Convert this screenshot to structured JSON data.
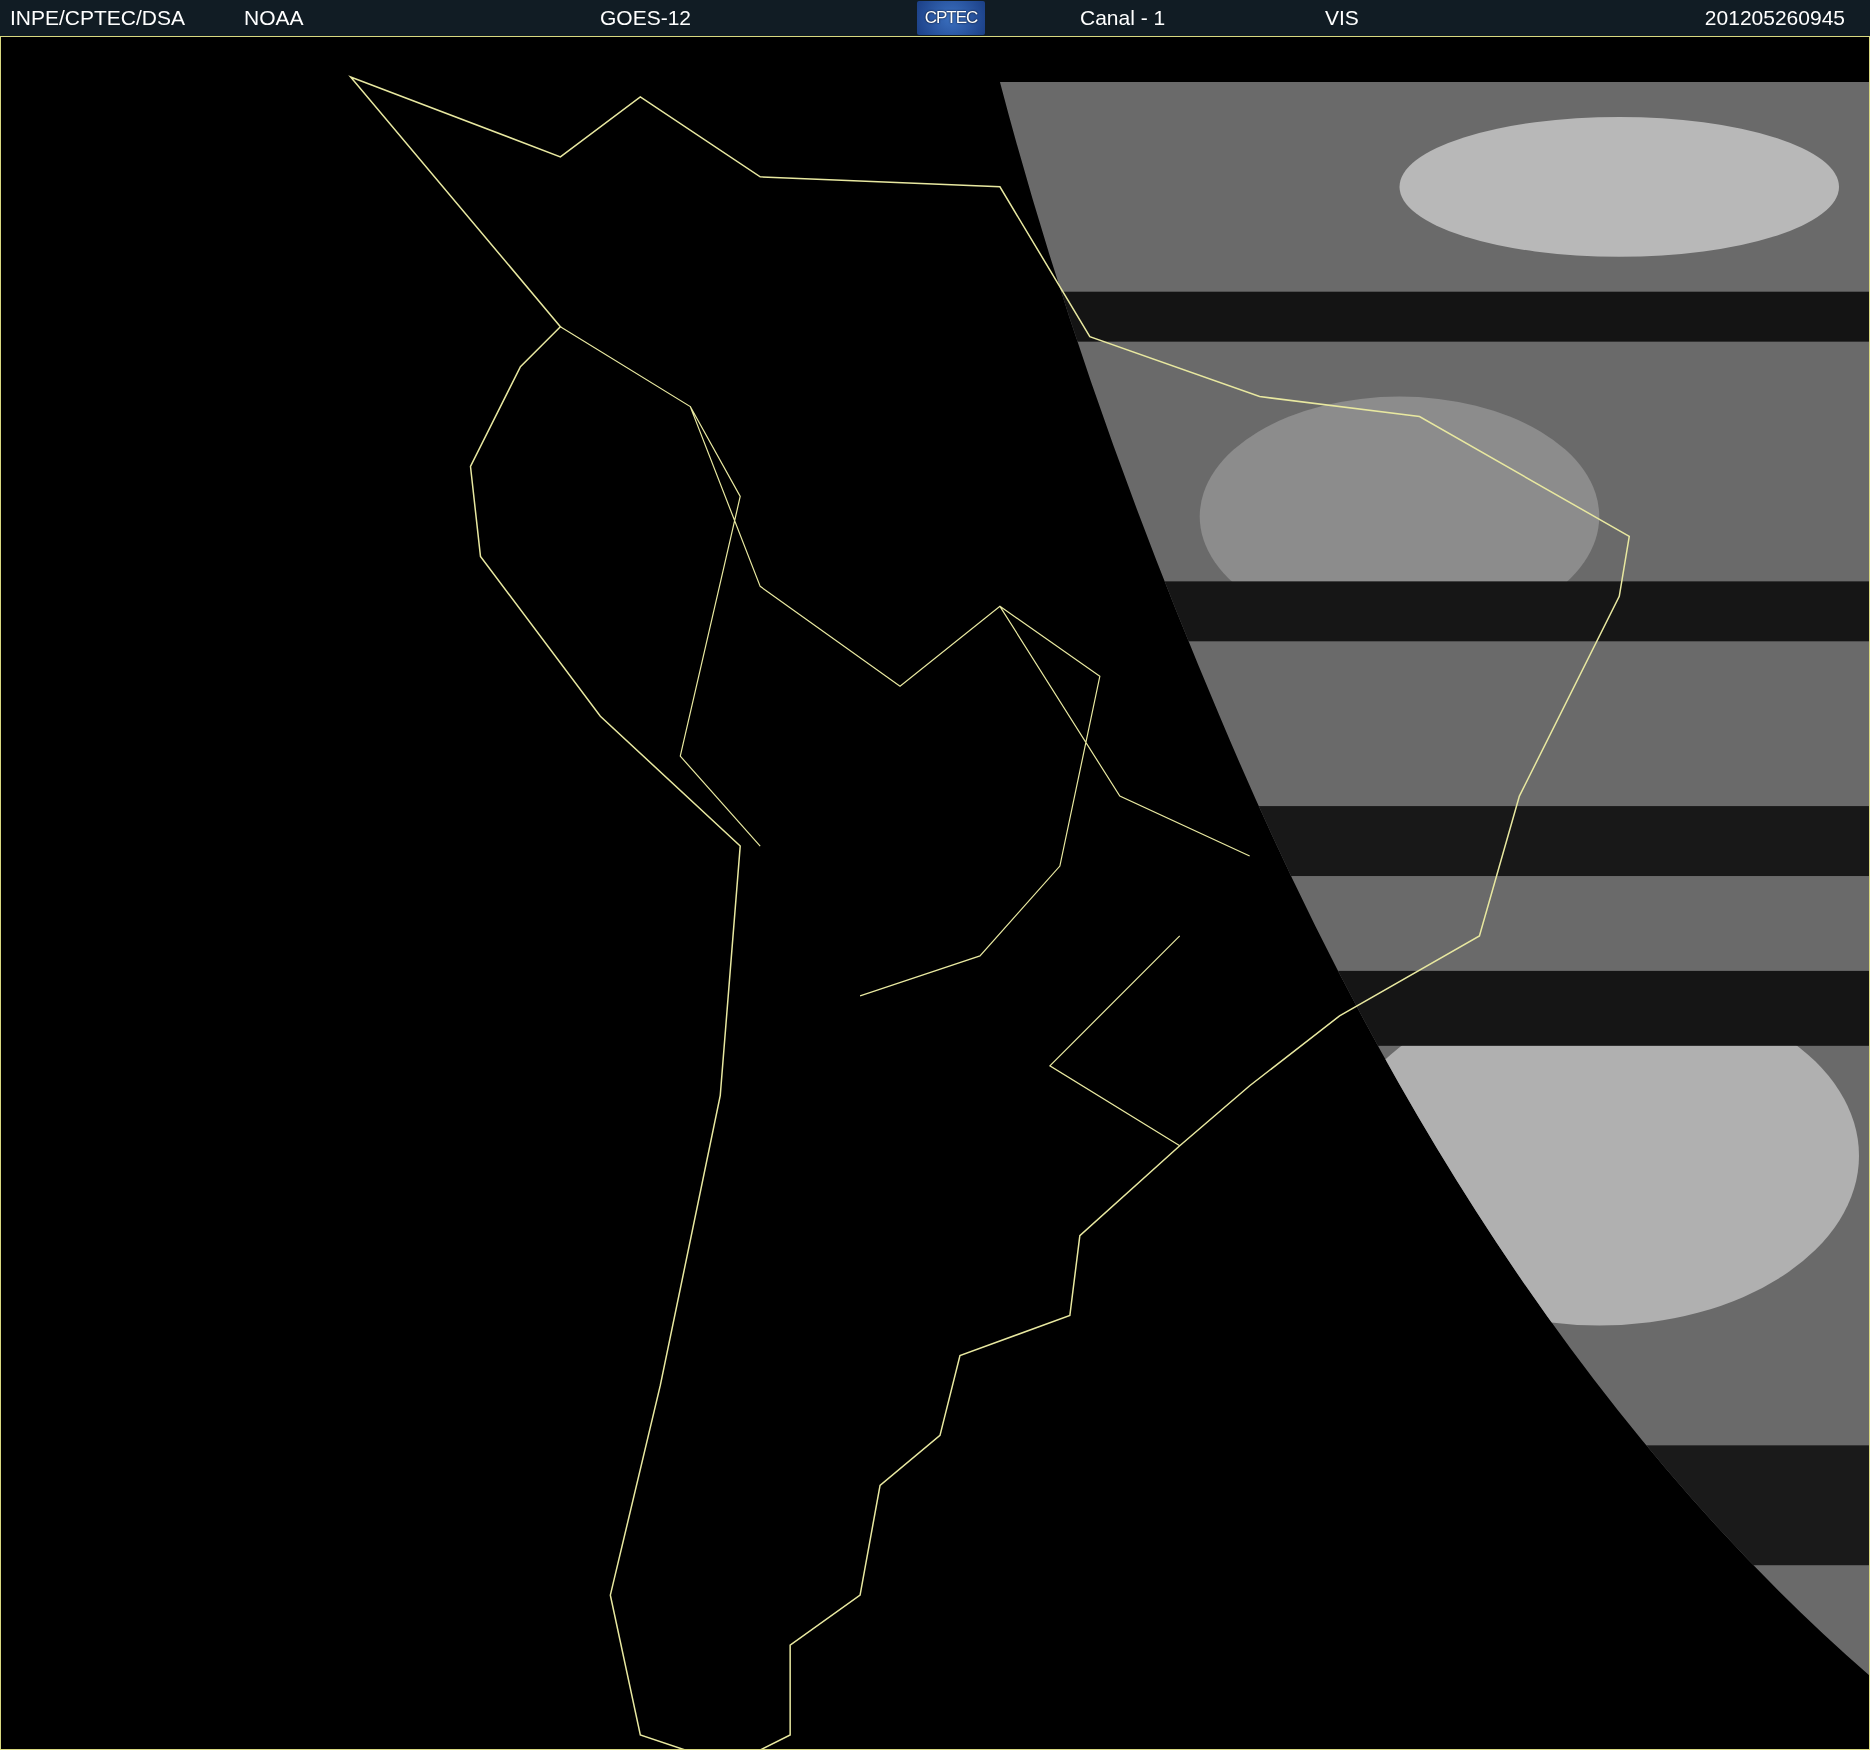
{
  "header": {
    "items": [
      {
        "kind": "text",
        "text": "INPE/CPTEC/DSA"
      },
      {
        "kind": "text",
        "text": "NOAA"
      },
      {
        "kind": "text",
        "text": "GOES-12"
      },
      {
        "kind": "logo",
        "text": "CPTEC"
      },
      {
        "kind": "text",
        "text": "Canal - 1"
      },
      {
        "kind": "text",
        "text": "VIS"
      },
      {
        "kind": "text",
        "text": "201205260945"
      }
    ]
  }
}
